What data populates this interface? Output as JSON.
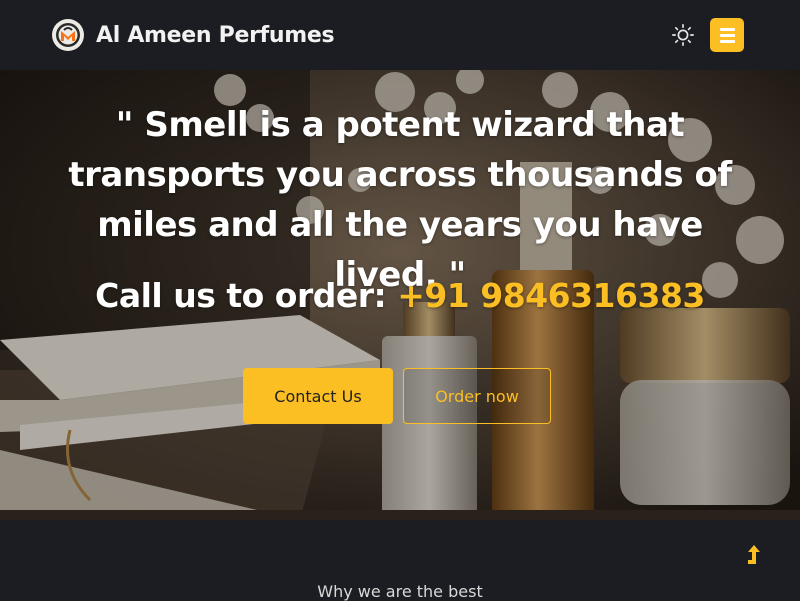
{
  "header": {
    "brand_name": "Al Ameen Perfumes",
    "icons": {
      "logo": "brand-logo-icon",
      "theme": "sun-icon",
      "menu": "hamburger-menu-icon"
    }
  },
  "hero": {
    "quote": "\" Smell is a potent wizard that transports you across thousands of miles and all the years you have lived. \"",
    "call_label": "Call us to order:",
    "phone": "+91 9846316383",
    "contact_button": "Contact Us",
    "order_button": "Order now"
  },
  "section": {
    "title": "Why we are the best",
    "scroll_top_icon": "arrow-up-icon"
  },
  "colors": {
    "accent": "#fbbf24",
    "background": "#1c1d22",
    "text": "#ffffff"
  }
}
